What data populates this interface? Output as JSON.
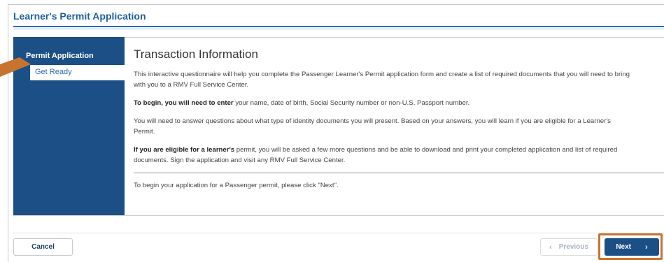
{
  "header": {
    "title": "Learner's Permit Application"
  },
  "sidebar": {
    "heading": "Permit Application",
    "items": [
      {
        "label": "Get Ready",
        "active": true
      }
    ]
  },
  "main": {
    "title": "Transaction Information",
    "paragraphs": [
      {
        "bold": "",
        "text": "This interactive questionnaire will help you complete the Passenger Learner's Permit application form and create a list of required documents that you will need to bring with you to a RMV Full Service Center."
      },
      {
        "bold": "To begin, you will need to enter",
        "text": " your name, date of birth, Social Security number or non-U.S. Passport number."
      },
      {
        "bold": "",
        "text": "You will need to answer questions about what type of identity documents you will present. Based on your answers, you will learn if you are eligible for a Learner's Permit."
      },
      {
        "bold": "If you are eligible for a learner's",
        "text": " permit, you will be asked a few more questions and be able to download and print your completed application and list of required documents. Sign the application and visit any RMV Full Service Center."
      }
    ],
    "closing": "To begin your application for a Passenger permit, please click \"Next\"."
  },
  "footer": {
    "cancel_label": "Cancel",
    "previous_label": "Previous",
    "next_label": "Next",
    "previous_icon": "chevron-left-icon",
    "next_icon": "chevron-right-icon"
  },
  "colors": {
    "brand_blue": "#1b4f86",
    "link_blue": "#2a6ebb",
    "highlight_orange": "#c8742f"
  }
}
